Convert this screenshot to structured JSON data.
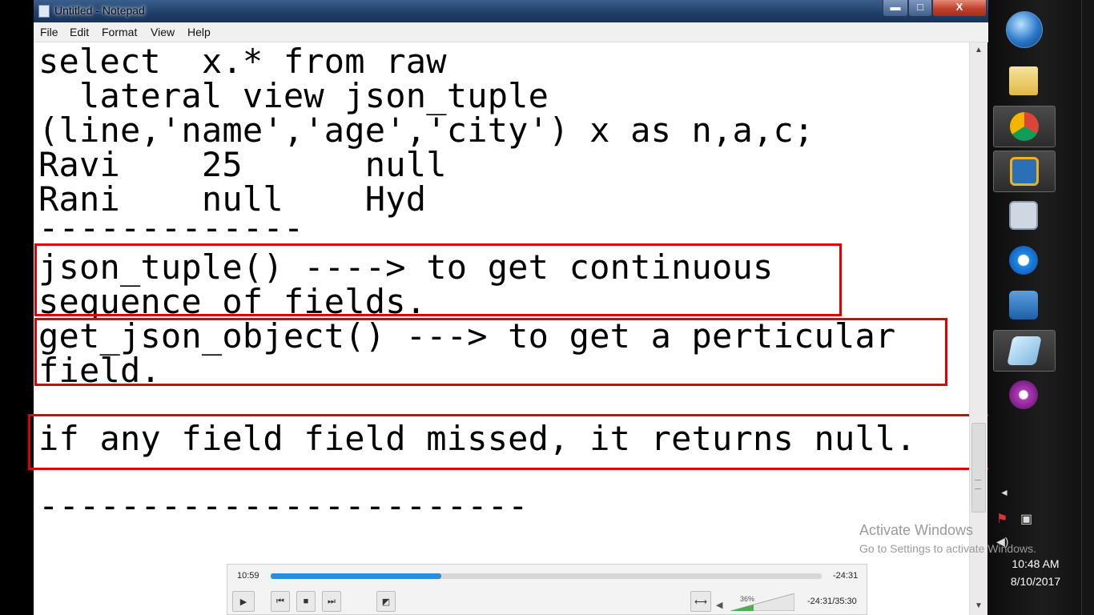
{
  "window": {
    "title": "Untitled - Notepad",
    "min": "▬",
    "max": "□",
    "close": "X"
  },
  "menu": [
    "File",
    "Edit",
    "Format",
    "View",
    "Help"
  ],
  "editor": {
    "lines": [
      "select  x.* from raw",
      "  lateral view json_tuple",
      "(line,'name','age','city') x as n,a,c;",
      "Ravi    25      null",
      "Rani    null    Hyd",
      "-------------",
      "json_tuple() ----> to get continuous",
      "sequence of fields.",
      "get_json_object() ---> to get a perticular",
      "field.",
      "if any field field missed, it returns null.",
      "------------------------"
    ]
  },
  "watermark": {
    "title": "Activate Windows",
    "subtitle": "Go to Settings to activate Windows."
  },
  "taskbar": {
    "icons": [
      "start-orb-icon",
      "explorer-folder-icon",
      "chrome-icon",
      "virtualbox-icon",
      "image-viewer-icon",
      "internet-explorer-icon",
      "media-player-icon",
      "notepad-icon",
      "flower-app-icon"
    ],
    "clock_time": "10:48 AM",
    "clock_date": "8/10/2017"
  },
  "player": {
    "elapsed": "10:59",
    "remaining": "-24:31",
    "progress": 0.31,
    "volume": "36%",
    "time_total": "-24:31/35:30"
  },
  "colors": {
    "highlight_box": "#e00000",
    "seek_fill": "#2d8cd8"
  }
}
